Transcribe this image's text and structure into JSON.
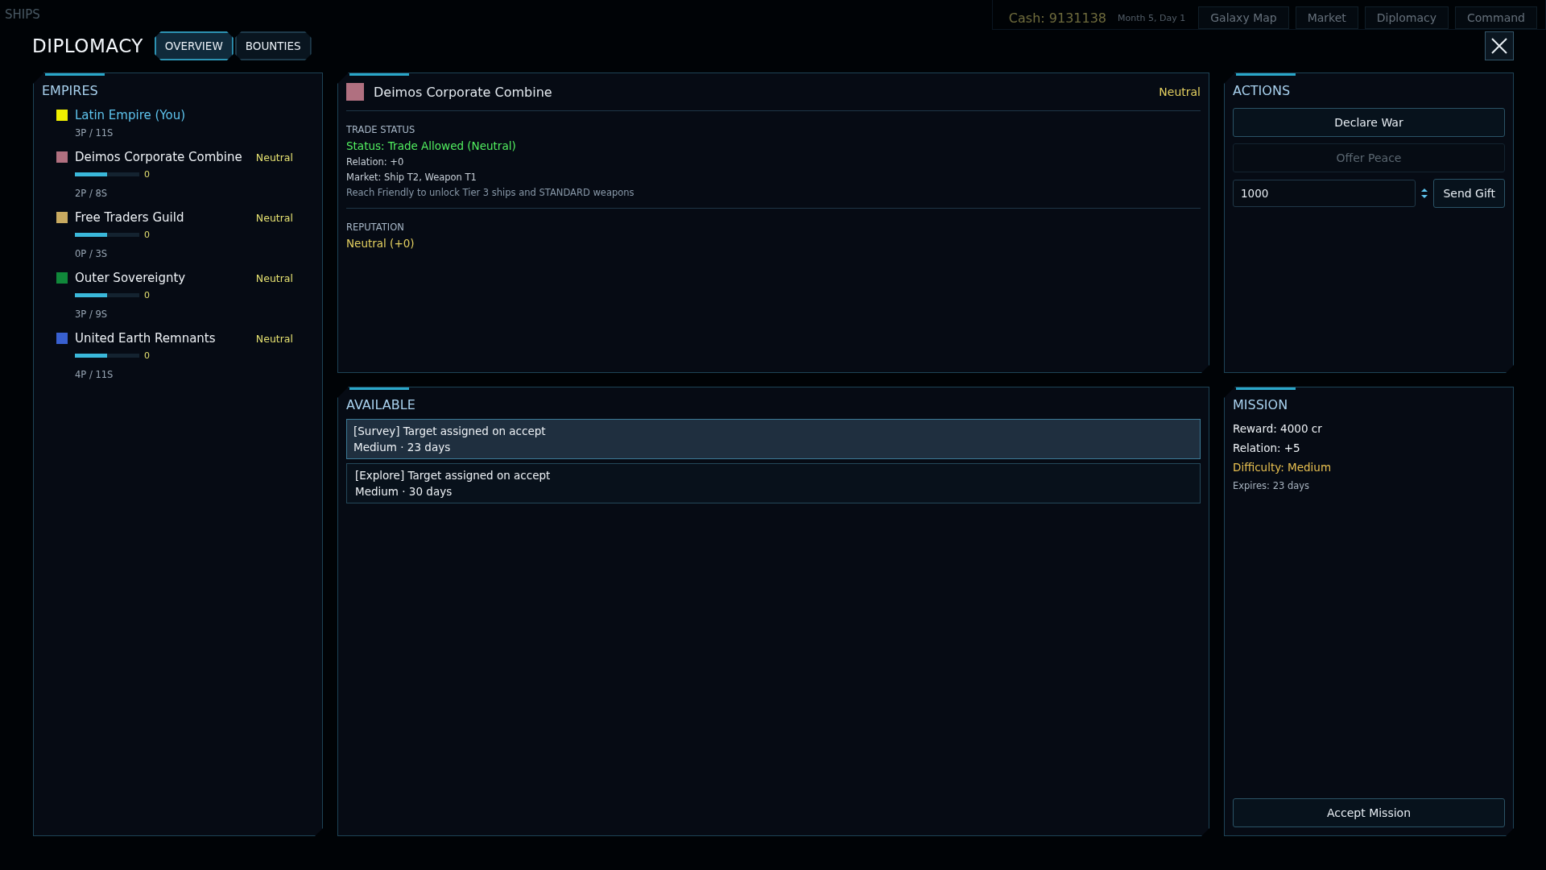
{
  "background": {
    "section_title": "SHIPS",
    "cash": "Cash: 9131138",
    "date": "Month 5, Day 1",
    "nav": [
      {
        "label": "Galaxy Map"
      },
      {
        "label": "Market"
      },
      {
        "label": "Diplomacy"
      },
      {
        "label": "Command"
      }
    ]
  },
  "title": "DIPLOMACY",
  "tabs": [
    {
      "label": "OVERVIEW",
      "selected": true
    },
    {
      "label": "BOUNTIES",
      "selected": false
    }
  ],
  "empires": {
    "title": "EMPIRES",
    "items": [
      {
        "kind": "player",
        "name": "Latin Empire (You)",
        "color": "#f0f000",
        "stats": "3P / 11S"
      },
      {
        "kind": "empire",
        "name": "Deimos Corporate Combine",
        "color": "#b07080",
        "status": "Neutral",
        "level": 0.5,
        "relation": "0",
        "stats": "2P / 8S"
      },
      {
        "kind": "empire",
        "name": "Free Traders Guild",
        "color": "#c8aa60",
        "status": "Neutral",
        "level": 0.5,
        "relation": "0",
        "stats": "0P / 3S"
      },
      {
        "kind": "empire",
        "name": "Outer Sovereignty",
        "color": "#10883a",
        "status": "Neutral",
        "level": 0.5,
        "relation": "0",
        "stats": "3P / 9S"
      },
      {
        "kind": "empire",
        "name": "United Earth Remnants",
        "color": "#3860d0",
        "status": "Neutral",
        "level": 0.5,
        "relation": "0",
        "stats": "4P / 11S"
      }
    ]
  },
  "detail": {
    "name": "Deimos Corporate Combine",
    "color": "#b07080",
    "status": "Neutral",
    "trade": {
      "heading": "TRADE STATUS",
      "status": "Status: Trade Allowed (Neutral)",
      "relation": "Relation: +0",
      "market": "Market: Ship T2, Weapon T1",
      "hint": "Reach Friendly to unlock Tier 3 ships and STANDARD weapons"
    },
    "reputation": {
      "heading": "REPUTATION",
      "value": "Neutral (+0)"
    }
  },
  "actions": {
    "title": "ACTIONS",
    "buttons": [
      {
        "label": "Declare War",
        "disabled": false
      },
      {
        "label": "Offer Peace",
        "disabled": true
      }
    ],
    "gift_amount": "1000",
    "gift_button": "Send Gift"
  },
  "available": {
    "title": "AVAILABLE",
    "missions": [
      {
        "title": "[Survey] Target assigned on accept",
        "meta": "Medium  ·  23 days",
        "selected": true
      },
      {
        "title": "[Explore] Target assigned on accept",
        "meta": "Medium  ·  30 days",
        "selected": false
      }
    ]
  },
  "mission": {
    "title": "MISSION",
    "reward": "Reward: 4000 cr",
    "relation": "Relation: +5",
    "difficulty": "Difficulty: Medium",
    "expires": "Expires: 23 days",
    "accept": "Accept Mission"
  }
}
